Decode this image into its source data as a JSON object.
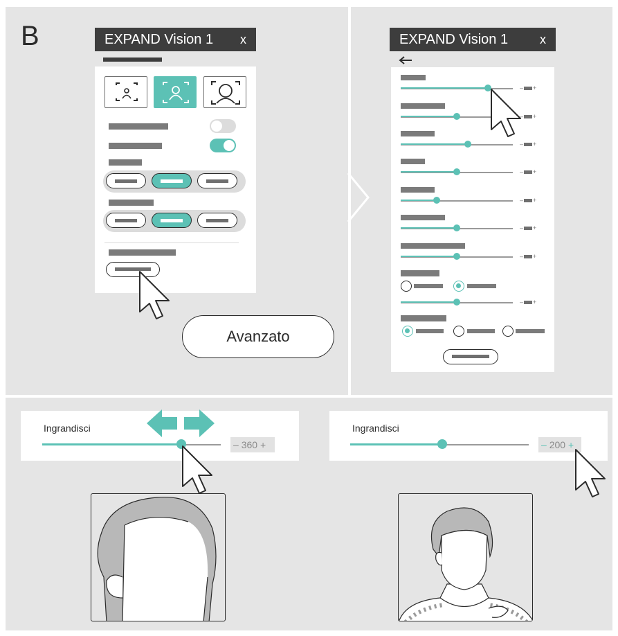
{
  "panel_letter": "B",
  "window_left": {
    "title": "EXPAND Vision 1",
    "close_label": "x"
  },
  "window_right": {
    "title": "EXPAND Vision 1",
    "close_label": "x",
    "back_icon": "arrow-left-icon"
  },
  "advanced_button": {
    "label": "Avanzato"
  },
  "zoom_left": {
    "label": "Ingrandisci",
    "value": "360",
    "minus": "–",
    "plus": "+",
    "level": 0.78
  },
  "zoom_right": {
    "label": "Ingrandisci",
    "value": "200",
    "minus": "–",
    "plus": "+",
    "level": 0.52
  },
  "colors": {
    "accent": "#5cc1b5",
    "dark": "#3d3d3d",
    "panel": "#e5e5e5"
  },
  "right_sliders": [
    0.78,
    0.5,
    0.6,
    0.5,
    0.32,
    0.5,
    0.5,
    0.5
  ]
}
